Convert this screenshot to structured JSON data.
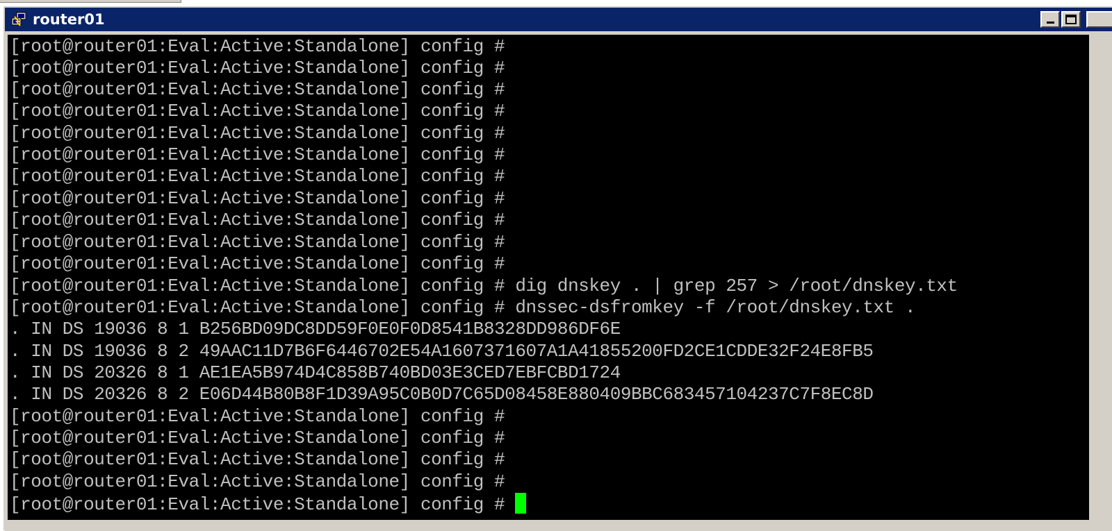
{
  "window": {
    "title": "router01"
  },
  "terminal": {
    "lines": [
      "[root@router01:Eval:Active:Standalone] config #",
      "[root@router01:Eval:Active:Standalone] config #",
      "[root@router01:Eval:Active:Standalone] config #",
      "[root@router01:Eval:Active:Standalone] config #",
      "[root@router01:Eval:Active:Standalone] config #",
      "[root@router01:Eval:Active:Standalone] config #",
      "[root@router01:Eval:Active:Standalone] config #",
      "[root@router01:Eval:Active:Standalone] config #",
      "[root@router01:Eval:Active:Standalone] config #",
      "[root@router01:Eval:Active:Standalone] config #",
      "[root@router01:Eval:Active:Standalone] config #",
      "[root@router01:Eval:Active:Standalone] config # dig dnskey . | grep 257 > /root/dnskey.txt",
      "[root@router01:Eval:Active:Standalone] config # dnssec-dsfromkey -f /root/dnskey.txt .",
      ". IN DS 19036 8 1 B256BD09DC8DD59F0E0F0D8541B8328DD986DF6E",
      ". IN DS 19036 8 2 49AAC11D7B6F6446702E54A1607371607A1A41855200FD2CE1CDDE32F24E8FB5",
      ". IN DS 20326 8 1 AE1EA5B974D4C858B740BD03E3CED7EBFCBD1724",
      ". IN DS 20326 8 2 E06D44B80B8F1D39A95C0B0D7C65D08458E880409BBC683457104237C7F8EC8D",
      "[root@router01:Eval:Active:Standalone] config #",
      "[root@router01:Eval:Active:Standalone] config #",
      "[root@router01:Eval:Active:Standalone] config #",
      "[root@router01:Eval:Active:Standalone] config #"
    ],
    "prompt": "[root@router01:Eval:Active:Standalone] config # "
  },
  "colors": {
    "terminal_bg": "#000000",
    "terminal_fg": "#c0c0c0",
    "cursor": "#00ff00",
    "titlebar": "#0a246a"
  },
  "icons": {
    "window_icon": "putty-icon",
    "minimize": "minimize-icon",
    "maximize": "maximize-icon"
  }
}
